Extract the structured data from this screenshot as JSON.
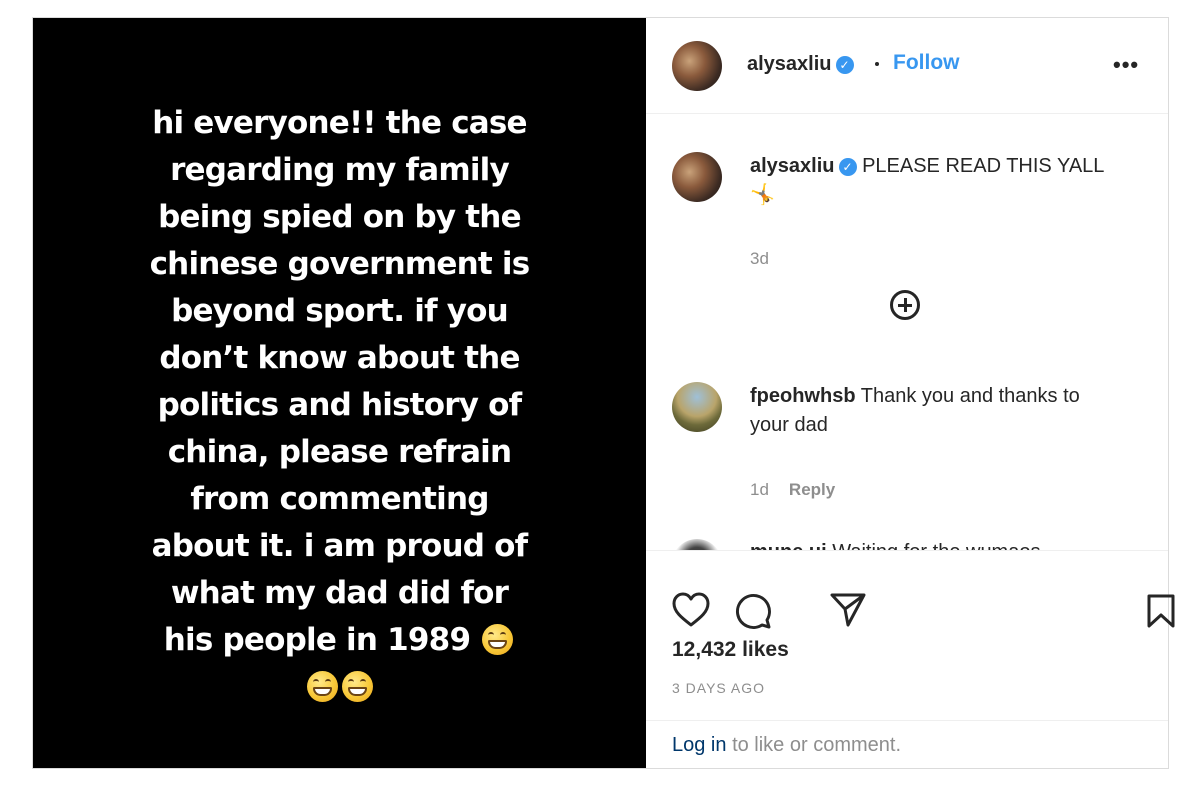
{
  "story": {
    "lines": [
      "hi everyone!! the case",
      "regarding my family",
      "being spied on by the",
      "chinese government is",
      "beyond sport. if you",
      "don’t know about the",
      "politics and history of",
      "china, please refrain",
      "from commenting",
      "about it. i am proud of",
      "what my dad did for",
      "his people in 1989"
    ],
    "emoji": "grinning-face-emoji"
  },
  "header": {
    "username": "alysaxliu",
    "verified": true,
    "follow_label": "Follow",
    "more_label": "•••"
  },
  "caption": {
    "username": "alysaxliu",
    "text": "PLEASE READ THIS YALL",
    "emoji": "🤸",
    "age": "3d"
  },
  "comments": [
    {
      "username": "fpeohwhsb",
      "text_line1": "Thank you and thanks to",
      "text_line2": "your dad",
      "age": "1d",
      "reply_label": "Reply"
    },
    {
      "username": "mune.ui",
      "text": "Waiting for the wumaos"
    }
  ],
  "actions": {
    "likes": "12,432 likes",
    "date": "3 DAYS AGO"
  },
  "login_bar": {
    "link": "Log in",
    "text": "to like or comment."
  },
  "colors": {
    "accent": "#3897f0",
    "text": "#262626",
    "muted": "#8e8e8e",
    "login_link": "#00376b"
  }
}
